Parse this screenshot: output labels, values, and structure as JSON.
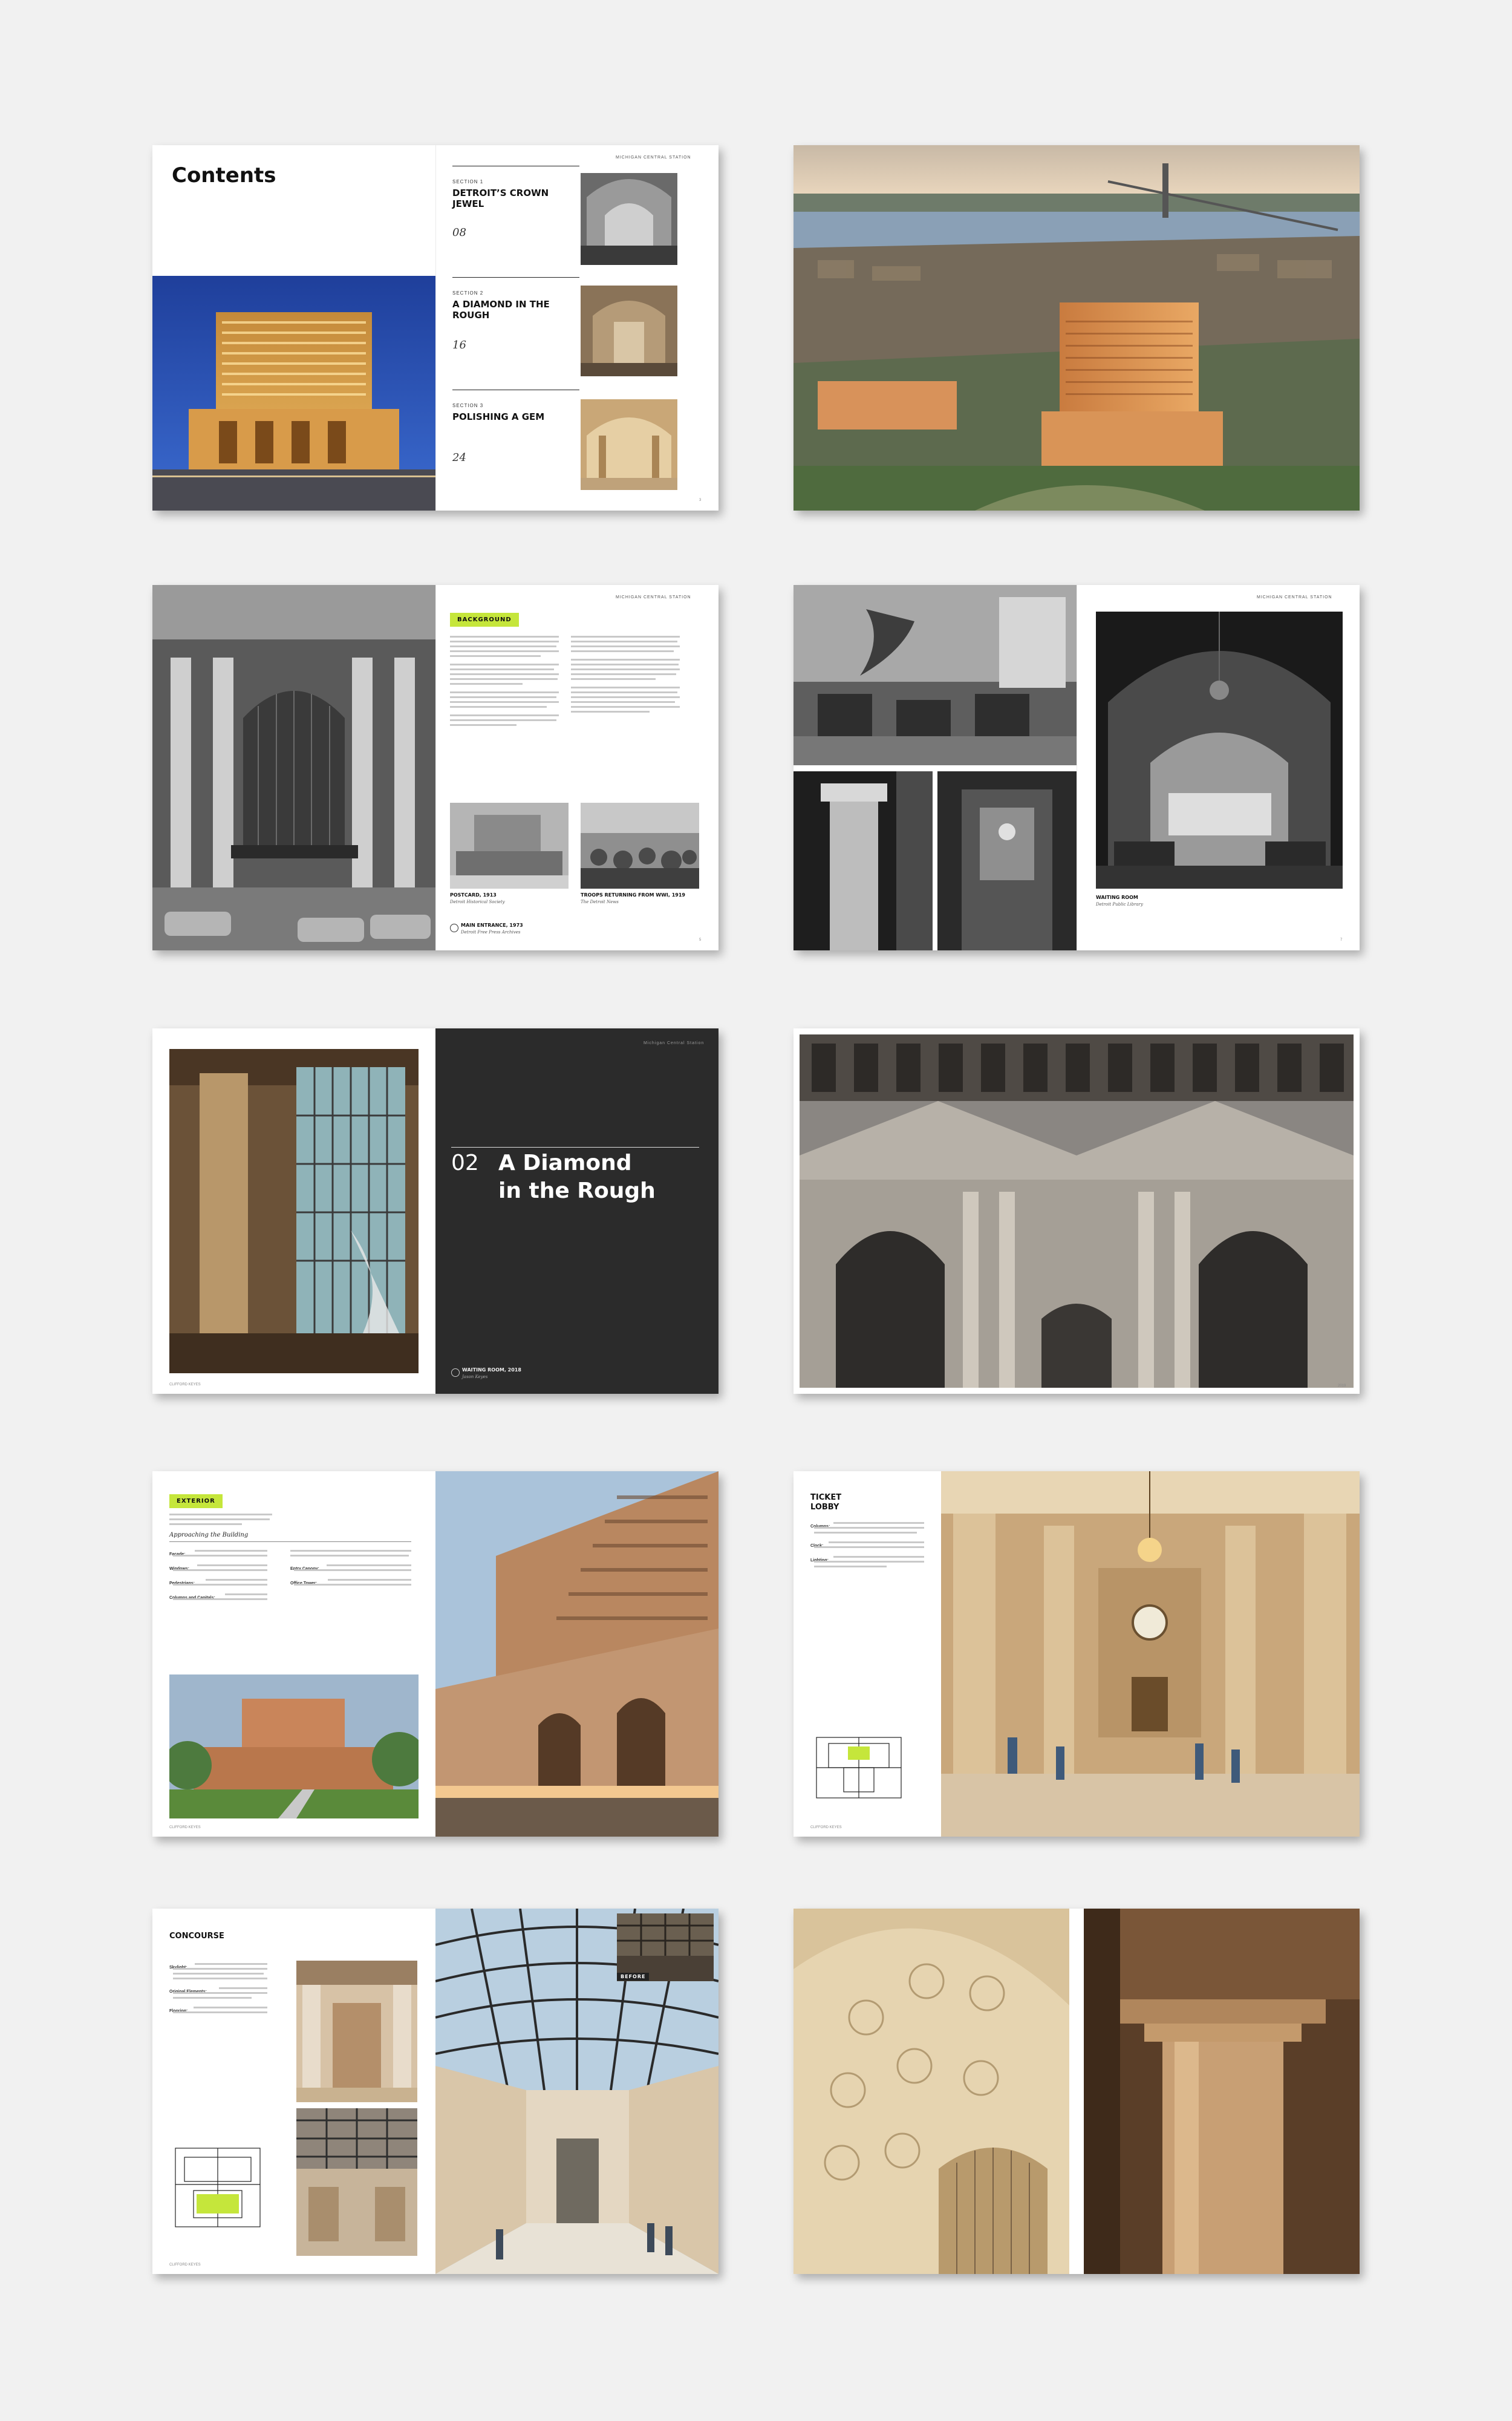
{
  "spread1": {
    "contents_title": "Contents",
    "running_head": "MICHIGAN CENTRAL STATION",
    "sections": [
      {
        "label": "SECTION 1",
        "title": "DETROIT’S CROWN JEWEL",
        "page": "08"
      },
      {
        "label": "SECTION 2",
        "title": "A DIAMOND IN THE ROUGH",
        "page": "16"
      },
      {
        "label": "SECTION 3",
        "title": "POLISHING A GEM",
        "page": "24"
      }
    ]
  },
  "spread2": {
    "running_head": "MICHIGAN CENTRAL STATION"
  },
  "spread3": {
    "running_head": "MICHIGAN CENTRAL STATION",
    "tag": "BACKGROUND",
    "captions": [
      {
        "title": "POSTCARD, 1913",
        "source": "Detroit Historical Society"
      },
      {
        "title": "TROOPS RETURNING FROM WWI, 1919",
        "source": "The Detroit News"
      },
      {
        "title": "MAIN ENTRANCE, 1973",
        "source": "Detroit Free Press Archives"
      }
    ]
  },
  "spread4": {
    "running_head": "MICHIGAN CENTRAL STATION",
    "caption_title": "WAITING ROOM",
    "caption_source": "Detroit Public Library"
  },
  "spread5": {
    "running_head": "Michigan Central Station",
    "number": "02",
    "title_line1": "A Diamond",
    "title_line2": "in the Rough",
    "caption_title": "WAITING ROOM, 2018",
    "caption_source": "Jason Keyes"
  },
  "spread6": {},
  "spread7": {
    "tag": "EXTERIOR",
    "subhead": "Approaching the Building",
    "bullets": [
      "Facade:",
      "Windows:",
      "Pedestrians:",
      "Columns and Capitals:",
      "Entry Canopy:",
      "Office Tower:"
    ]
  },
  "spread8": {
    "heading_line1": "TICKET",
    "heading_line2": "LOBBY",
    "bullets": [
      "Columns:",
      "Clock:",
      "Lighting:"
    ]
  },
  "spread9": {
    "heading": "CONCOURSE",
    "before_label": "BEFORE",
    "bullets": [
      "Skylight:",
      "Original Elements:",
      "Flooring:"
    ]
  },
  "spread10": {},
  "colors": {
    "background": "#f1f1f1",
    "accent": "#c5e63b",
    "dark_panel": "#2b2b2b"
  }
}
